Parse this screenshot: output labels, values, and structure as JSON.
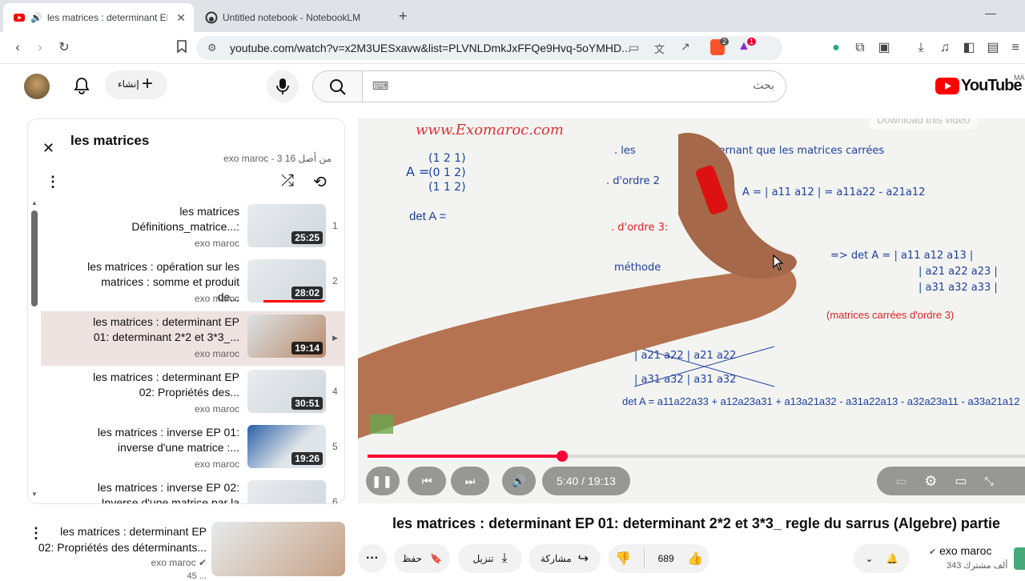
{
  "browser": {
    "tabs": [
      {
        "title": "les matrices : determinant EP",
        "active": true
      },
      {
        "title": "Untitled notebook - NotebookLM",
        "active": false
      }
    ],
    "url": "youtube.com/watch?v=x2M3UESxavw&list=PLVNLDmkJxFFQe9Hvq-5oYMHD...",
    "badge_count": "2",
    "alert_count": "1"
  },
  "youtube": {
    "logo_text": "YouTube",
    "region_code": "MA",
    "search_placeholder": "بحث",
    "create_label": "إنشاء"
  },
  "playlist": {
    "title": "les matrices",
    "meta": "exo maroc - 3 من أصل 16",
    "items": [
      {
        "index": "1",
        "title_line1": "les matrices",
        "title_line2": "Définitions_matrice...:",
        "channel": "exo maroc",
        "duration": "25:25",
        "active": false
      },
      {
        "index": "2",
        "title_line1": "les matrices : opération sur les",
        "title_line2": "matrices : somme et produit de...",
        "channel": "exo maroc",
        "duration": "28:02",
        "active": false
      },
      {
        "index": "▶",
        "title_line1": "les matrices : determinant EP",
        "title_line2": "01: determinant 2*2 et 3*3_...",
        "channel": "exo maroc",
        "duration": "19:14",
        "active": true
      },
      {
        "index": "4",
        "title_line1": "les matrices : determinant EP",
        "title_line2": "02: Propriétés des...",
        "channel": "exo maroc",
        "duration": "30:51",
        "active": false
      },
      {
        "index": "5",
        "title_line1": "les matrices : inverse EP 01:",
        "title_line2": "inverse d'une matrice :...",
        "channel": "exo maroc",
        "duration": "19:26",
        "active": false
      },
      {
        "index": "6",
        "title_line1": "les matrices : inverse EP 02:",
        "title_line2": "Inverse d'une matrice par la",
        "channel": "",
        "duration": "",
        "active": false
      }
    ]
  },
  "recommendation": {
    "title_line1": "les matrices : determinant  EP",
    "title_line2": "02: Propriétés des déterminants...",
    "channel": "exo maroc",
    "meta": "45 ..."
  },
  "player": {
    "current_time": "5:40",
    "duration": "19:13",
    "progress": 0.296,
    "download_label": "Download this video",
    "board_text": {
      "site": "www.Exomaroc.com",
      "matrix_label": "A =",
      "det_label": "det A =",
      "sarrus_note": "(matrices carrées d'ordre 3)",
      "formula": "det A = a11a22a33 + a12a23a31 + a13a21a32 - a31a22a13 - a32a23a11 - a33a21a12"
    }
  },
  "video": {
    "title": "les matrices : determinant EP 01: determinant 2*2 et 3*3_ regle du sarrus (Algebre) partie",
    "channel": "exo maroc",
    "subscribers": "343 ألف مشترك",
    "likes": "689",
    "share_label": "مشاركة",
    "download_label": "تنزيل",
    "save_label": "حفظ"
  },
  "colors": {
    "youtube_red": "#ff0000",
    "progress_red": "#f03",
    "accent_tab": "#dfe3e8"
  }
}
